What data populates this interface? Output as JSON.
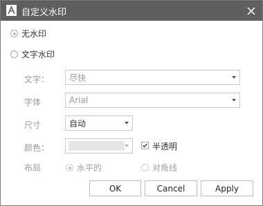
{
  "window": {
    "title": "自定义水印",
    "app_icon": "watermark-app-icon",
    "close_icon": "close-icon"
  },
  "options": {
    "no_watermark": {
      "label": "无水印",
      "selected": true
    },
    "text_watermark": {
      "label": "文字水印",
      "selected": false
    }
  },
  "fields": {
    "text": {
      "label": "文字：",
      "value": "尽快"
    },
    "font": {
      "label": "字体",
      "value": "Arial"
    },
    "size": {
      "label": "尺寸",
      "value": "自动"
    },
    "color": {
      "label": "颜色：",
      "swatch": "#e6e6e6"
    },
    "semi_transparent": {
      "label": "半透明",
      "checked": true
    },
    "layout": {
      "label": "布局",
      "horizontal": {
        "label": "水平的",
        "selected": true
      },
      "diagonal": {
        "label": "对角线",
        "selected": false
      }
    }
  },
  "buttons": {
    "ok": "OK",
    "cancel": "Cancel",
    "apply": "Apply"
  },
  "colors": {
    "titlebar": "#5f5f5f",
    "disabled_text": "#9a9a9a",
    "border": "#c8c8c8"
  }
}
